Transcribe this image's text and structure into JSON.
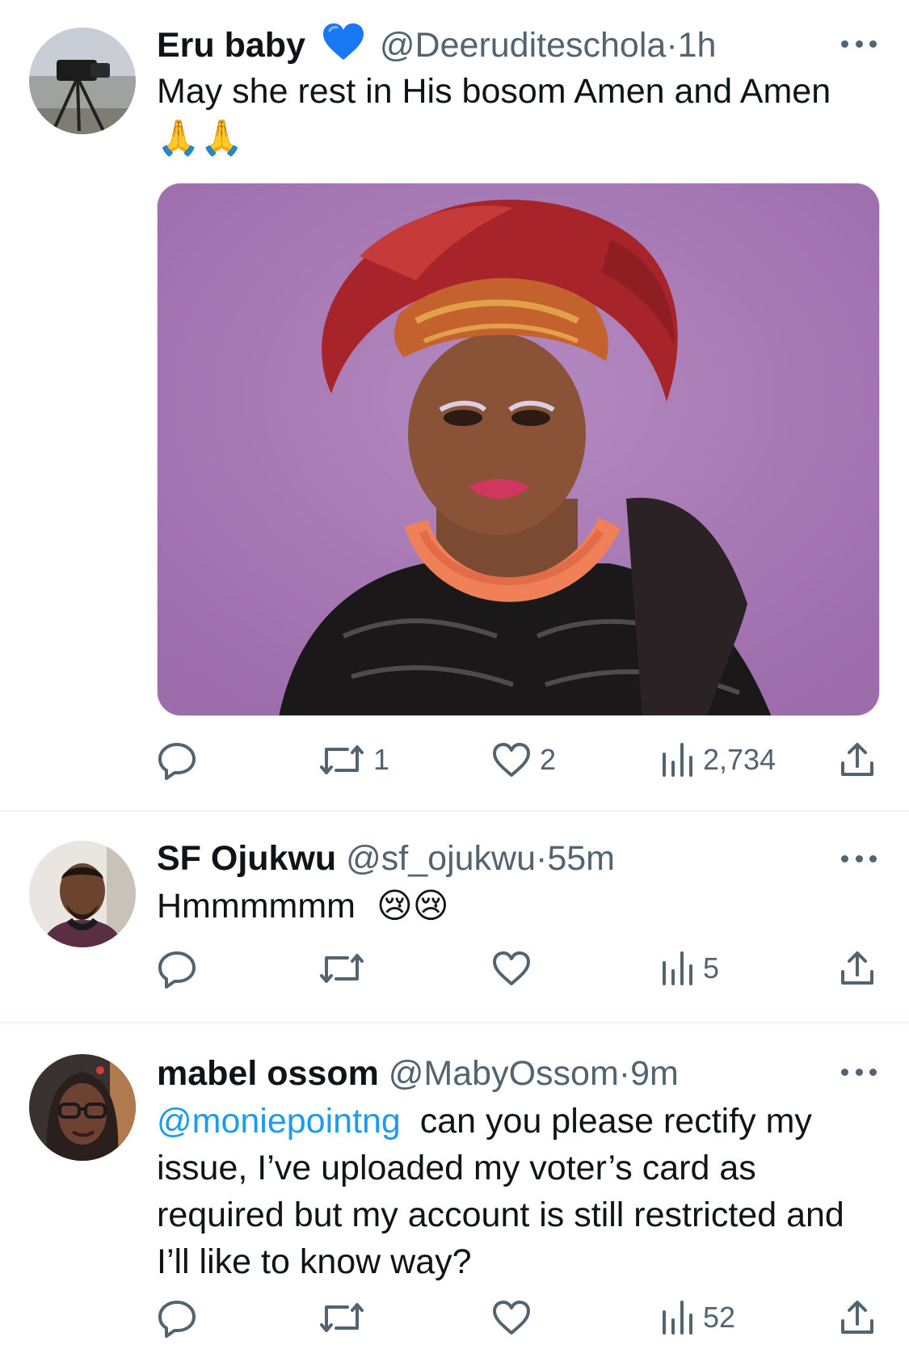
{
  "tweets": [
    {
      "name": "Eru baby",
      "handle": "@Deeruditeschola",
      "dot": "·",
      "time": "1h",
      "text": "May she rest in His bosom Amen and Amen",
      "emoji": "🙏🙏",
      "replies": "",
      "retweets": "1",
      "likes": "2",
      "views": "2,734"
    },
    {
      "name": "SF Ojukwu",
      "handle": "@sf_ojukwu",
      "dot": "·",
      "time": "55m",
      "text": "Hmmmmmm",
      "emoji": "😢😢",
      "replies": "",
      "retweets": "",
      "likes": "",
      "views": "5"
    },
    {
      "name": "mabel ossom",
      "handle": "@MabyOssom",
      "dot": "·",
      "time": "9m",
      "mention": "@moniepointng",
      "text": "can you please rectify my issue, I’ve uploaded my voter’s card as required but my account is still restricted and I’ll like to know way?",
      "replies": "",
      "retweets": "",
      "likes": "",
      "views": "52"
    }
  ],
  "icons": {
    "verified": "blue-heart-icon",
    "reply": "reply-icon",
    "retweet": "retweet-icon",
    "like": "heart-icon",
    "views": "views-icon",
    "share": "share-icon",
    "more": "more-icon"
  },
  "colors": {
    "text": "#0f1419",
    "secondary": "#536471",
    "link": "#1d9bf0",
    "photo_bg": "#a77ab5"
  }
}
